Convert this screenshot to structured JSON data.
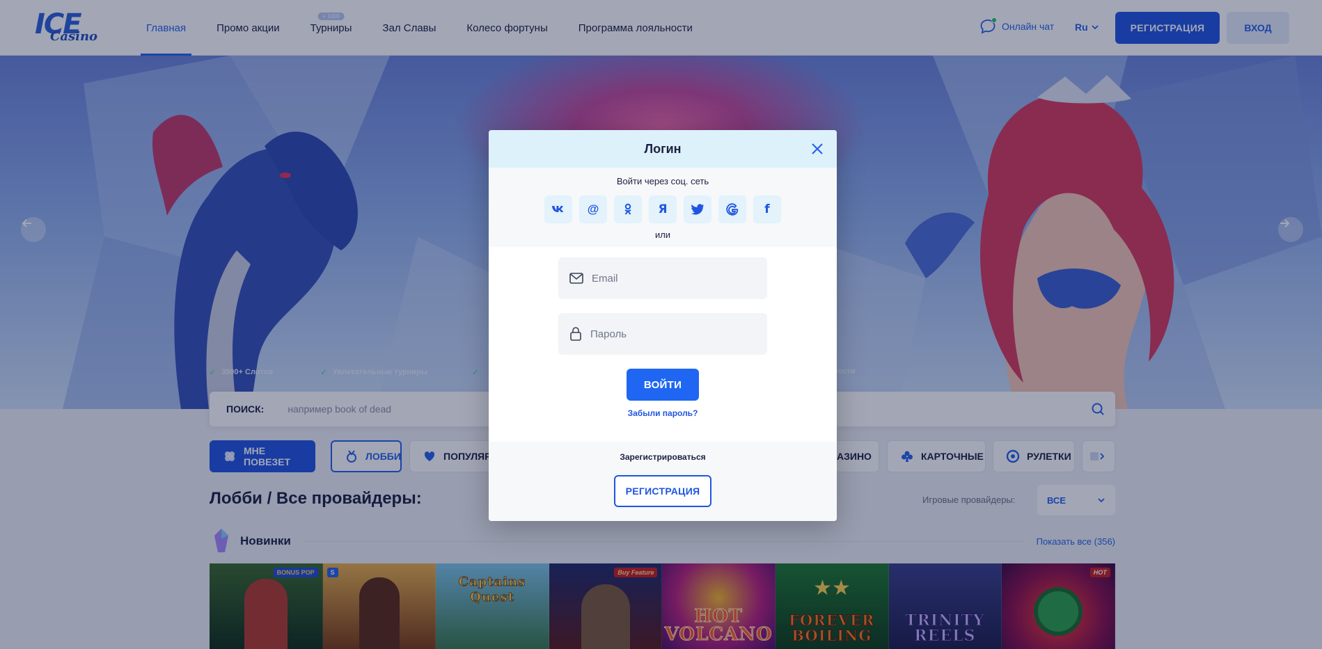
{
  "header": {
    "logo_top": "ICE",
    "logo_bottom": "Casino",
    "nav": [
      {
        "label": "Главная",
        "active": true
      },
      {
        "label": "Промо акции"
      },
      {
        "label": "Турниры",
        "badge": "+ 1000"
      },
      {
        "label": "Зал Славы"
      },
      {
        "label": "Колесо фортуны"
      },
      {
        "label": "Программа лояльности"
      }
    ],
    "chat_label": "Онлайн чат",
    "lang": "Ru",
    "register_button": "РЕГИСТРАЦИЯ",
    "login_button": "ВХОД"
  },
  "hero": {
    "features": [
      "3500+ Слотов",
      "Увлекательные турниры",
      "",
      "ности"
    ]
  },
  "search": {
    "label": "ПОИСК:",
    "placeholder": "например book of dead"
  },
  "categories": [
    {
      "label": "МНЕ ПОВЕЗЕТ",
      "icon": "clover-icon"
    },
    {
      "label": "ЛОББИ",
      "icon": "medal-icon"
    },
    {
      "label": "ПОПУЛЯРН",
      "icon": "heart-icon"
    },
    {
      "label": "АЗИНО",
      "icon": "casino-icon"
    },
    {
      "label": "КАРТОЧНЫЕ",
      "icon": "club-icon"
    },
    {
      "label": "РУЛЕТКИ",
      "icon": "roulette-icon"
    }
  ],
  "lobby": {
    "title": "Лобби / Все провайдеры:",
    "providers_label": "Игровые провайдеры:",
    "providers_value": "ВСЕ",
    "section_title": "Новинки",
    "show_all": "Показать все (356)"
  },
  "games": [
    {
      "title": "",
      "badge": "BONUS POP"
    },
    {
      "title": "",
      "badge": "S"
    },
    {
      "title": "Captains Quest",
      "badge": ""
    },
    {
      "title": "",
      "badge": "Buy Feature"
    },
    {
      "title": "HOT VOLCANO",
      "badge": ""
    },
    {
      "title": "FOREVER BOILING",
      "badge": ""
    },
    {
      "title": "TRINITY REELS",
      "badge": ""
    },
    {
      "title": "",
      "badge": "HOT"
    }
  ],
  "modal": {
    "title": "Логин",
    "social_caption": "Войти через соц. сеть",
    "social": [
      {
        "name": "vk-icon",
        "glyph": "vk"
      },
      {
        "name": "mail-icon",
        "glyph": "@"
      },
      {
        "name": "odnoklassniki-icon",
        "glyph": "ok"
      },
      {
        "name": "yandex-icon",
        "glyph": "Я"
      },
      {
        "name": "twitter-icon",
        "glyph": "tw"
      },
      {
        "name": "google-icon",
        "glyph": "G"
      },
      {
        "name": "facebook-icon",
        "glyph": "f"
      }
    ],
    "or": "или",
    "email_placeholder": "Email",
    "password_placeholder": "Пароль",
    "submit": "ВОЙТИ",
    "forgot": "Забыли пароль?",
    "register_caption": "Зарегистрироваться",
    "register_button": "РЕГИСТРАЦИЯ"
  },
  "colors": {
    "accent": "#1f55e0",
    "modal_head": "#ddf1fb",
    "overlay": "#0d163c"
  }
}
